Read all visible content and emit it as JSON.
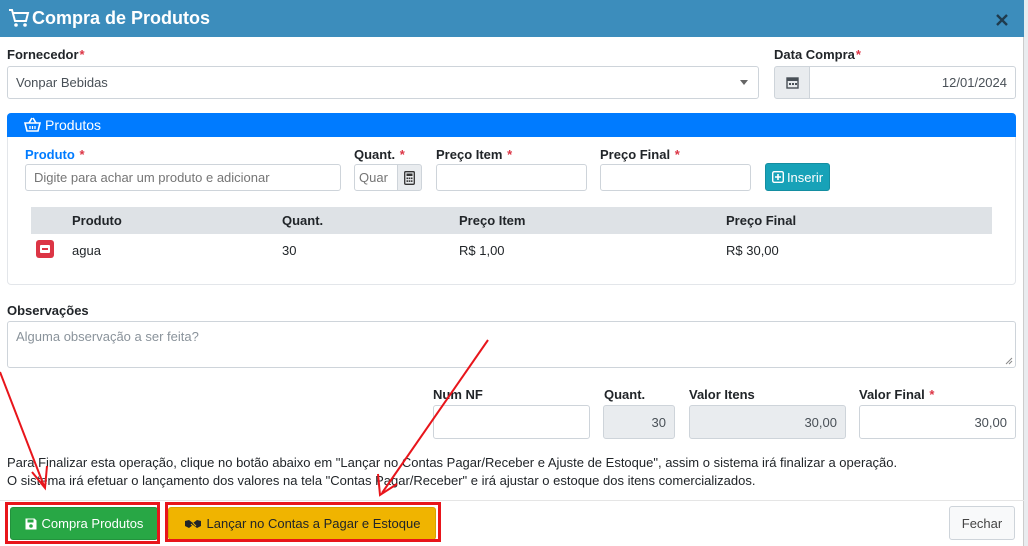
{
  "modal": {
    "title": "Compra de Produtos",
    "icons": {
      "title": "cart-icon",
      "close": "close-icon"
    }
  },
  "fornecedor": {
    "label": "Fornecedor",
    "required": "*",
    "value": "Vonpar Bebidas"
  },
  "data_compra": {
    "label": "Data Compra",
    "required": "*",
    "value": "12/01/2024",
    "icon": "calendar-icon"
  },
  "produtos_card": {
    "title": "Produtos",
    "icon": "basket-icon",
    "fields": {
      "produto": {
        "label": "Produto",
        "required": "*",
        "placeholder": "Digite para achar um produto e adicionar"
      },
      "quant": {
        "label": "Quant.",
        "required": "*",
        "placeholder": "Quar",
        "icon": "calculator-icon"
      },
      "preco_item": {
        "label": "Preço Item",
        "required": "*"
      },
      "preco_final": {
        "label": "Preço Final",
        "required": "*"
      }
    },
    "inserir_label": "Inserir",
    "table": {
      "columns": [
        "Produto",
        "Quant.",
        "Preço Item",
        "Preço Final"
      ],
      "rows": [
        {
          "produto": "agua",
          "quant": "30",
          "preco_item": "R$ 1,00",
          "preco_final": "R$ 30,00"
        }
      ]
    }
  },
  "observacoes": {
    "label": "Observações",
    "placeholder": "Alguma observação a ser feita?"
  },
  "totals": {
    "num_nf": {
      "label": "Num NF",
      "value": ""
    },
    "quant": {
      "label": "Quant.",
      "value": "30"
    },
    "valor_itens": {
      "label": "Valor Itens",
      "value": "30,00"
    },
    "valor_final": {
      "label": "Valor Final",
      "required": "*",
      "value": "30,00"
    }
  },
  "message": {
    "line1": "Para Finalizar esta operação, clique no botão abaixo em \"Lançar no Contas Pagar/Receber e Ajuste de Estoque\", assim o sistema irá finalizar a operação.",
    "line2": "O sistema irá efetuar o lançamento dos valores na tela \"Contas Pagar/Receber\" e irá ajustar o estoque dos itens comercializados."
  },
  "footer": {
    "compra_label": "Compra Produtos",
    "lancar_label": "Lançar no Contas a Pagar e Estoque",
    "fechar_label": "Fechar"
  },
  "colors": {
    "header": "#3c8dbc",
    "card_header": "#007bff",
    "success": "#28a745",
    "warning": "#f0b400",
    "info": "#17a2b8",
    "annotation": "#e8151b"
  }
}
